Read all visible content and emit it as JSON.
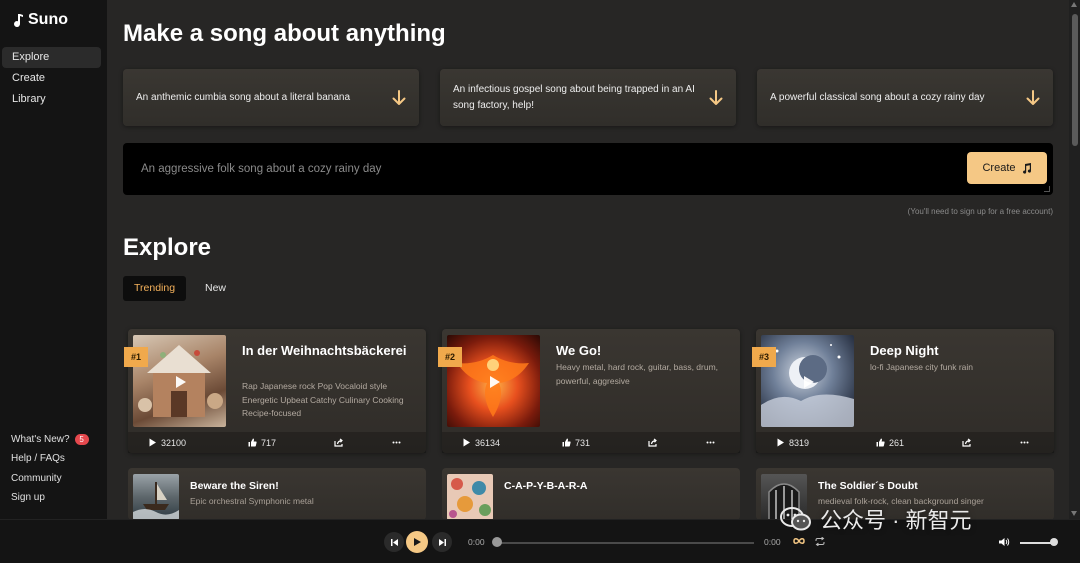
{
  "app": {
    "name": "Suno"
  },
  "sidebar": {
    "items": [
      {
        "label": "Explore",
        "active": true
      },
      {
        "label": "Create"
      },
      {
        "label": "Library"
      }
    ],
    "bottom": {
      "whats_new": "What's New?",
      "whats_new_badge": "5",
      "help": "Help / FAQs",
      "community": "Community",
      "signup": "Sign up"
    }
  },
  "main": {
    "headline": "Make a song about anything",
    "prompts": [
      "An anthemic cumbia song about a literal banana",
      "An infectious gospel song about being trapped in an AI song factory, help!",
      "A powerful classical song about a cozy rainy day"
    ],
    "input": {
      "placeholder": "An aggressive folk song about a cozy rainy day"
    },
    "create_label": "Create",
    "signup_note": "(You'll need to sign up for a free account)",
    "explore_title": "Explore",
    "tabs": [
      {
        "label": "Trending",
        "active": true
      },
      {
        "label": "New"
      }
    ],
    "songs": [
      {
        "rank": "#1",
        "title": "In der Weihnachtsbäckerei",
        "tags": "Rap Japanese rock Pop Vocaloid style Energetic Upbeat Catchy Culinary Cooking Recipe-focused",
        "plays": "32100",
        "likes": "717"
      },
      {
        "rank": "#2",
        "title": "We Go!",
        "tags": "Heavy metal, hard rock, guitar, bass, drum, powerful, aggresive",
        "plays": "36134",
        "likes": "731"
      },
      {
        "rank": "#3",
        "title": "Deep Night",
        "tags": "lo-fi Japanese city funk rain",
        "plays": "8319",
        "likes": "261"
      }
    ],
    "songs_row2": [
      {
        "title": "Beware the Siren!",
        "tags": "Epic orchestral Symphonic metal"
      },
      {
        "title": "C-A-P-Y-B-A-R-A",
        "tags": ""
      },
      {
        "title": "The Soldier´s Doubt",
        "tags": "medieval folk-rock, clean background singer"
      }
    ]
  },
  "player": {
    "time_current": "0:00",
    "time_total": "0:00",
    "progress": 0,
    "volume": 0.9
  },
  "watermark": {
    "text": "公众号 · 新智元"
  },
  "colors": {
    "accent": "#f5c885",
    "rank": "#f0a94c",
    "tab_active_text": "#f4b15b",
    "badge": "#e5484d"
  }
}
